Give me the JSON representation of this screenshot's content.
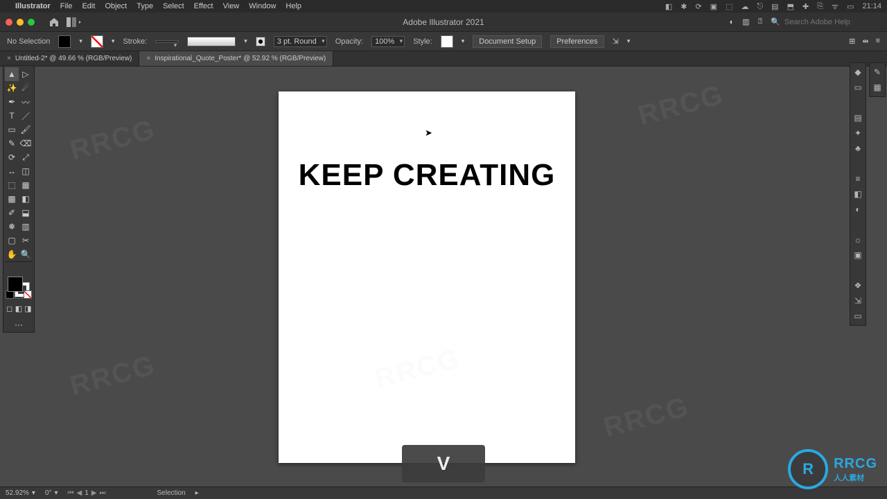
{
  "os": {
    "app_name": "Illustrator",
    "menus": [
      "File",
      "Edit",
      "Object",
      "Type",
      "Select",
      "Effect",
      "View",
      "Window",
      "Help"
    ],
    "clock": "21:14"
  },
  "app_bar": {
    "title": "Adobe Illustrator 2021",
    "search_placeholder": "Search Adobe Help"
  },
  "control_bar": {
    "selection_state": "No Selection",
    "stroke_label": "Stroke:",
    "stroke_profile": "3 pt. Round",
    "opacity_label": "Opacity:",
    "opacity_value": "100%",
    "style_label": "Style:",
    "doc_setup": "Document Setup",
    "preferences": "Preferences"
  },
  "tabs": [
    {
      "label": "Untitled-2* @ 49.66 % (RGB/Preview)",
      "active": false
    },
    {
      "label": "Inspirational_Quote_Poster* @ 52.92 % (RGB/Preview)",
      "active": true
    }
  ],
  "document": {
    "headline": "KEEP CREATING"
  },
  "key_overlay": {
    "key": "V"
  },
  "status_bar": {
    "zoom": "52.92%",
    "rotation": "0°",
    "artboard_index": "1",
    "tool": "Selection"
  },
  "watermark_text": "RRCG",
  "rrcg_badge": {
    "monogram": "R",
    "big": "RRCG",
    "small": "人人素材"
  }
}
